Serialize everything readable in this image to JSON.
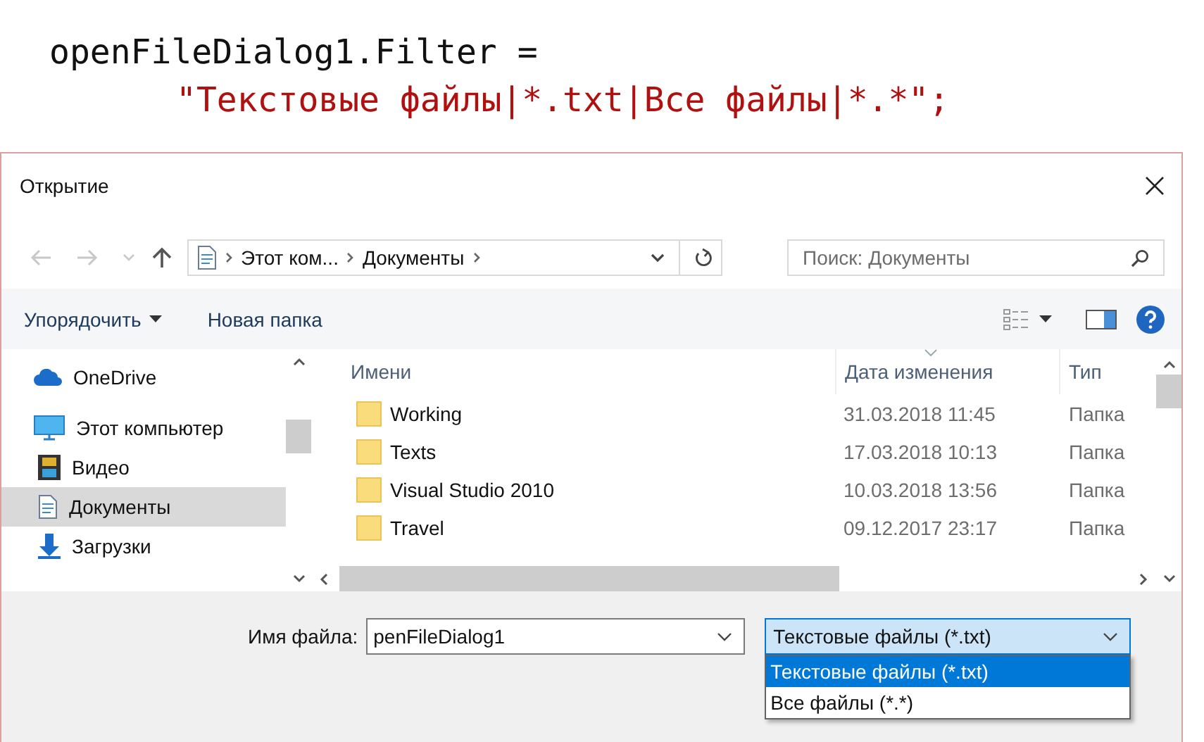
{
  "code": {
    "line_1": "openFileDialog1.Filter =",
    "line_2": "\"Текстовые файлы|*.txt|Все файлы|*.*\";"
  },
  "dialog": {
    "title": "Открытие",
    "breadcrumb": [
      "Этот ком...",
      "Документы"
    ],
    "search": {
      "placeholder": "Поиск: Документы"
    },
    "toolbar": {
      "organize": "Упорядочить",
      "new_folder": "Новая папка"
    },
    "sidebar": {
      "items": [
        {
          "label": "OneDrive",
          "kind": "cloud",
          "selected": false
        },
        {
          "label": "Этот компьютер",
          "kind": "computer",
          "selected": false
        },
        {
          "label": "Видео",
          "kind": "video",
          "selected": false
        },
        {
          "label": "Документы",
          "kind": "document",
          "selected": true
        },
        {
          "label": "Загрузки",
          "kind": "download",
          "selected": false
        }
      ]
    },
    "table": {
      "columns": [
        "Имени",
        "Дата изменения",
        "Тип"
      ],
      "rows": [
        {
          "name": "Working",
          "date": "31.03.2018 11:45",
          "type": "Папка"
        },
        {
          "name": "Texts",
          "date": "17.03.2018 10:13",
          "type": "Папка"
        },
        {
          "name": "Visual Studio 2010",
          "date": "10.03.2018 13:56",
          "type": "Папка"
        },
        {
          "name": "Travel",
          "date": "09.12.2017 23:17",
          "type": "Папка"
        }
      ]
    },
    "file_name": {
      "label": "Имя файла:",
      "value": "penFileDialog1"
    },
    "filter": {
      "value": "Текстовые файлы (*.txt)",
      "expanded": true,
      "options": [
        {
          "label": "Текстовые файлы (*.txt)",
          "selected": true
        },
        {
          "label": "Все файлы (*.*)",
          "selected": false
        }
      ]
    }
  }
}
